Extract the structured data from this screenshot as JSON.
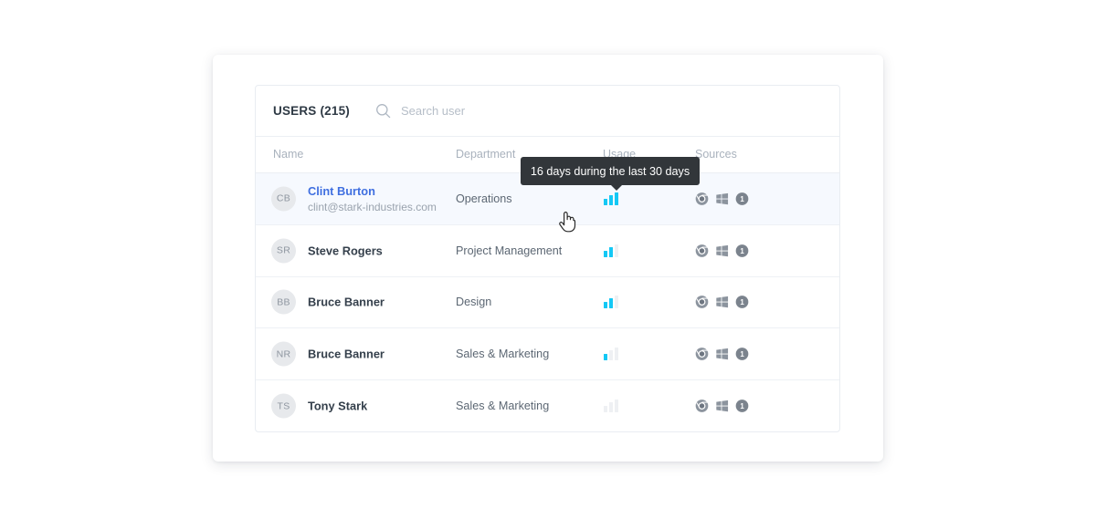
{
  "card": {
    "title": "USERS (215)",
    "search": {
      "placeholder": "Search user",
      "value": "",
      "icon": "search-icon"
    },
    "columns": {
      "name": "Name",
      "department": "Department",
      "usage": "Usage",
      "sources": "Sources"
    },
    "rows": [
      {
        "initials": "CB",
        "name": "Clint Burton",
        "email": "clint@stark-industries.com",
        "department": "Operations",
        "usage_bars": [
          true,
          true,
          true
        ],
        "sources": [
          "chrome-icon",
          "windows-icon",
          "badge-one-icon"
        ],
        "highlighted": true,
        "name_is_link": true
      },
      {
        "initials": "SR",
        "name": "Steve Rogers",
        "email": "",
        "department": "Project Management",
        "usage_bars": [
          true,
          true,
          false
        ],
        "sources": [
          "chrome-icon",
          "windows-icon",
          "badge-one-icon"
        ],
        "highlighted": false,
        "name_is_link": false
      },
      {
        "initials": "BB",
        "name": "Bruce Banner",
        "email": "",
        "department": "Design",
        "usage_bars": [
          true,
          true,
          false
        ],
        "sources": [
          "chrome-icon",
          "windows-icon",
          "badge-one-icon"
        ],
        "highlighted": false,
        "name_is_link": false
      },
      {
        "initials": "NR",
        "name": "Bruce Banner",
        "email": "",
        "department": "Sales & Marketing",
        "usage_bars": [
          true,
          false,
          false
        ],
        "sources": [
          "chrome-icon",
          "windows-icon",
          "badge-one-icon"
        ],
        "highlighted": false,
        "name_is_link": false
      },
      {
        "initials": "TS",
        "name": "Tony Stark",
        "email": "",
        "department": "Sales & Marketing",
        "usage_bars": [
          false,
          false,
          false
        ],
        "sources": [
          "chrome-icon",
          "windows-icon",
          "badge-one-icon"
        ],
        "highlighted": false,
        "name_is_link": false
      }
    ]
  },
  "tooltip": {
    "text": "16 days during the last 30 days"
  },
  "colors": {
    "accent_bar": "#14c8f5",
    "link": "#3f6fe0",
    "tooltip_bg": "#32363a",
    "row_highlight": "#f6f9fe"
  }
}
